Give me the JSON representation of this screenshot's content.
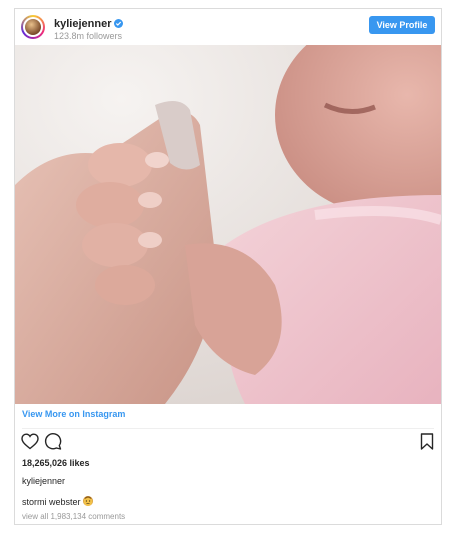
{
  "header": {
    "username": "kyliejenner",
    "followers": "123.8m followers",
    "view_profile_label": "View Profile"
  },
  "post": {
    "view_more_label": "View More on Instagram",
    "likes": "18,265,026 likes",
    "caption_username": "kyliejenner",
    "caption_text": "stormi webster",
    "view_comments": "view all 1,983,134 comments"
  },
  "icons": [
    "verified-icon",
    "heart-icon",
    "comment-icon",
    "bookmark-icon",
    "baby-emoji-icon"
  ],
  "colors": {
    "accent": "#3897f0",
    "text": "#262626",
    "muted": "#999999"
  }
}
